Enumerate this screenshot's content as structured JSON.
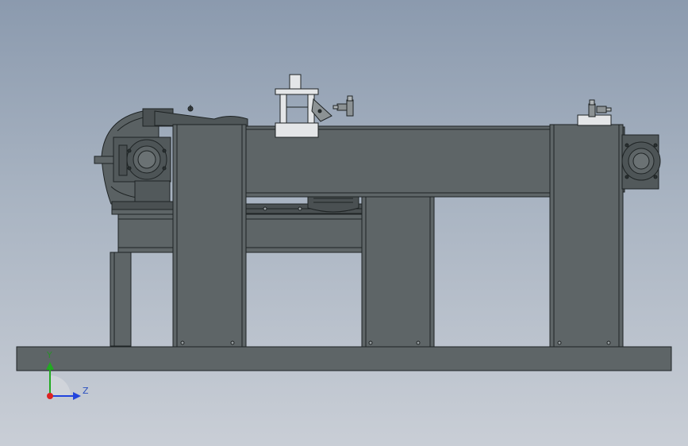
{
  "triad": {
    "y_label": "Y",
    "z_label": "Z",
    "y_color": "#22aa22",
    "z_color": "#2244dd",
    "x_color": "#dd2222"
  },
  "colors": {
    "body": "#5e6567",
    "body_dark": "#4a5052",
    "edge": "#1e2324",
    "white_part": "#e4e6e8"
  }
}
